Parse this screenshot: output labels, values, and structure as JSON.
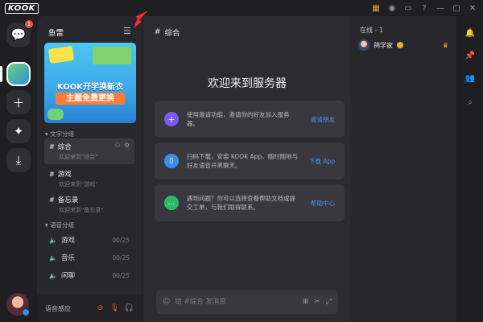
{
  "app": {
    "logo": "KOOK",
    "titlebar_icons": [
      {
        "name": "shop-icon",
        "glyph": "▦",
        "color": "#e8a33a"
      },
      {
        "name": "camera-icon",
        "glyph": "◉"
      },
      {
        "name": "folder-icon",
        "glyph": "▭"
      },
      {
        "name": "help-icon",
        "glyph": "?"
      },
      {
        "name": "minimize-icon",
        "glyph": "—"
      },
      {
        "name": "maximize-icon",
        "glyph": "▢"
      },
      {
        "name": "close-icon",
        "glyph": "✕"
      }
    ]
  },
  "rail": {
    "dm_badge": "1"
  },
  "server": {
    "name": "鱼雷",
    "banner": {
      "line1": "KOOK开学换新衣",
      "line2": "主题免费更换"
    }
  },
  "categories": {
    "text": "文字分组",
    "voice": "语音分组"
  },
  "text_channels": [
    {
      "name": "综合",
      "sub": "欢迎来到\"综合\"",
      "active": true
    },
    {
      "name": "游戏",
      "sub": "欢迎来到\"游戏\"",
      "active": false
    },
    {
      "name": "备忘录",
      "sub": "欢迎来到\"备忘录\"",
      "active": false
    }
  ],
  "voice_channels": [
    {
      "name": "游戏",
      "count": "00/25"
    },
    {
      "name": "音乐",
      "count": "00/25"
    },
    {
      "name": "闲聊",
      "count": "00/25"
    }
  ],
  "voice_bar": {
    "label": "语音感应"
  },
  "main": {
    "channel_title": "综合",
    "welcome": "欢迎来到服务器",
    "cards": [
      {
        "text": "使用邀请功能，邀请你的好友加入服务器。",
        "link": "邀请朋友",
        "color": "#7b5cf0",
        "icon": "＋"
      },
      {
        "text": "扫码下载，安装 KOOK App，随时随地与好友语音开黑聊天。",
        "link": "下载 App",
        "color": "#3b8cf0",
        "icon": "▯"
      },
      {
        "text": "遇到问题？你可以选择查看帮助文档或提交工单，与我们取得联系。",
        "link": "帮助中心",
        "color": "#2fb86a",
        "icon": "…"
      }
    ],
    "input_placeholder": "给 #综合 发消息"
  },
  "members": {
    "online": "在线 - 1",
    "list": [
      {
        "name": "鸽学家"
      }
    ]
  }
}
